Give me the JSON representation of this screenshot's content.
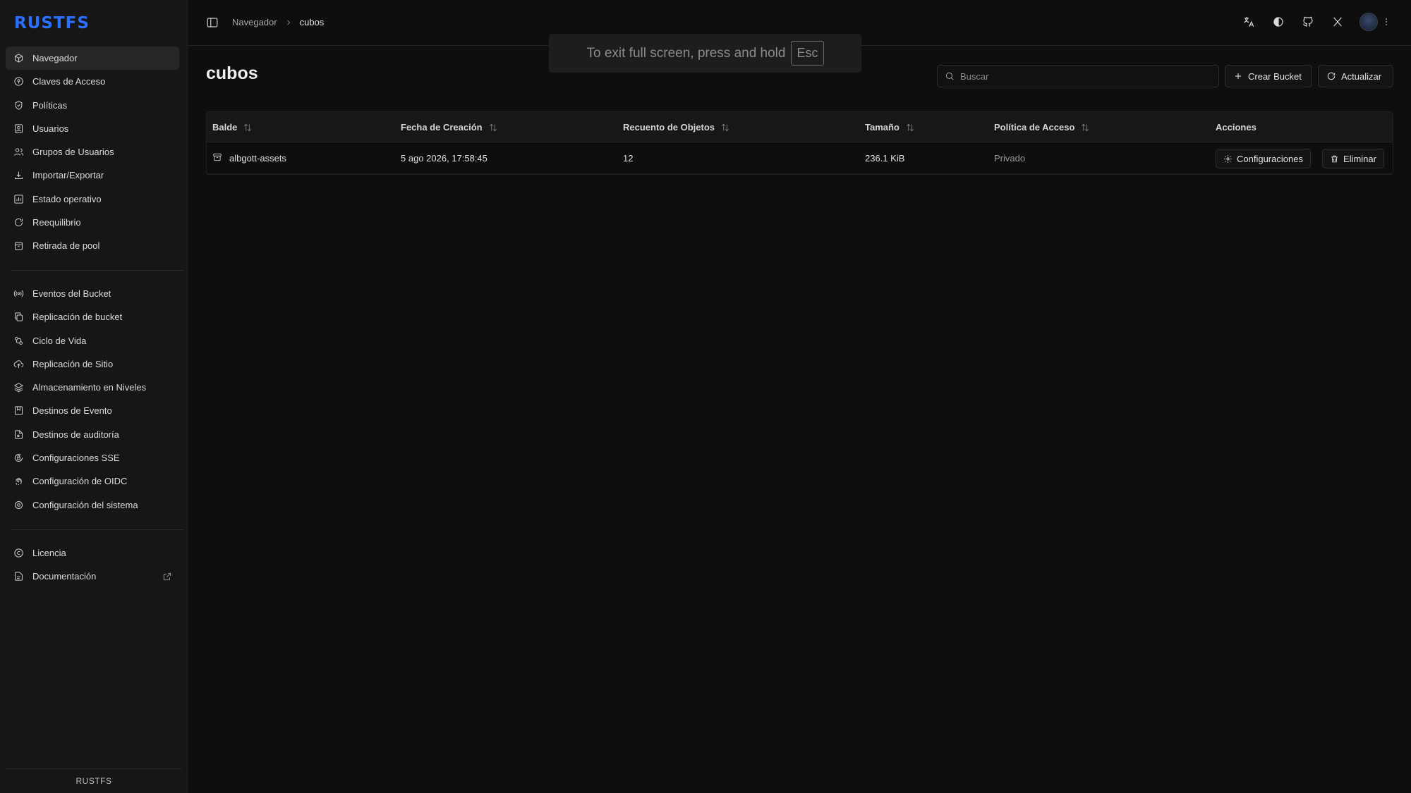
{
  "app": {
    "logo": "RUSTFS",
    "footer": "RUSTFS"
  },
  "sidebar": {
    "group1": [
      {
        "label": "Navegador",
        "icon": "cube-icon",
        "active": true
      },
      {
        "label": "Claves de Acceso",
        "icon": "key-circle-icon"
      },
      {
        "label": "Políticas",
        "icon": "shield-icon"
      },
      {
        "label": "Usuarios",
        "icon": "user-card-icon"
      },
      {
        "label": "Grupos de Usuarios",
        "icon": "users-icon"
      },
      {
        "label": "Importar/Exportar",
        "icon": "import-export-icon"
      },
      {
        "label": "Estado operativo",
        "icon": "chart-icon"
      },
      {
        "label": "Reequilibrio",
        "icon": "refresh-icon"
      },
      {
        "label": "Retirada de pool",
        "icon": "trash-box-icon"
      }
    ],
    "group2": [
      {
        "label": "Eventos del Bucket",
        "icon": "broadcast-icon"
      },
      {
        "label": "Replicación de bucket",
        "icon": "copy-icon"
      },
      {
        "label": "Ciclo de Vida",
        "icon": "lifecycle-icon"
      },
      {
        "label": "Replicación de Sitio",
        "icon": "cloud-upload-icon"
      },
      {
        "label": "Almacenamiento en Niveles",
        "icon": "layers-icon"
      },
      {
        "label": "Destinos de Evento",
        "icon": "bookmark-icon"
      },
      {
        "label": "Destinos de auditoría",
        "icon": "audit-file-icon"
      },
      {
        "label": "Configuraciones SSE",
        "icon": "lock-gear-icon"
      },
      {
        "label": "Configuración de OIDC",
        "icon": "fingerprint-icon"
      },
      {
        "label": "Configuración del sistema",
        "icon": "gear-icon"
      }
    ],
    "group3": [
      {
        "label": "Licencia",
        "icon": "copyright-icon"
      },
      {
        "label": "Documentación",
        "icon": "doc-icon",
        "external": true
      }
    ]
  },
  "topbar": {
    "breadcrumb": [
      "Navegador",
      "cubos"
    ]
  },
  "fullscreen_notice": {
    "text": "To exit full screen, press and hold",
    "key": "Esc"
  },
  "main": {
    "title": "cubos",
    "search_placeholder": "Buscar",
    "create_label": "Crear Bucket",
    "refresh_label": "Actualizar",
    "table": {
      "headers": {
        "bucket": "Balde",
        "created": "Fecha de Creación",
        "objects": "Recuento de Objetos",
        "size": "Tamaño",
        "policy": "Política de Acceso",
        "actions": "Acciones"
      },
      "rows": [
        {
          "name": "albgott-assets",
          "created": "5 ago 2026, 17:58:45",
          "objects": "12",
          "size": "236.1 KiB",
          "policy": "Privado",
          "settings_label": "Configuraciones",
          "delete_label": "Eliminar"
        }
      ]
    }
  }
}
